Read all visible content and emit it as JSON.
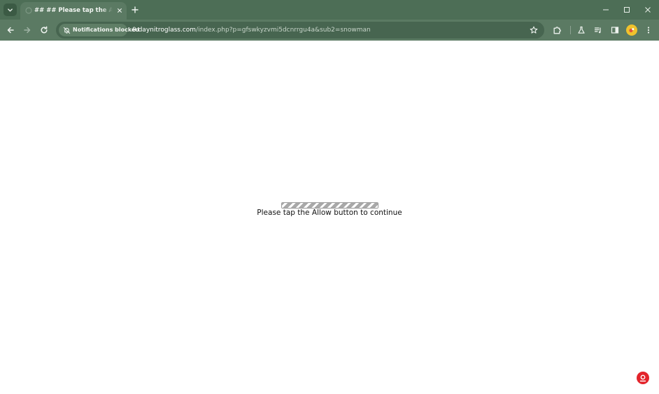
{
  "browser": {
    "tab": {
      "title": "## ## Please tap the Allow button to continue"
    },
    "omnibox": {
      "notification_chip": "Notifications blocked",
      "url_host": "0.daynitroglass.com",
      "url_path": "/index.php?p=gfswkyzvmi5dcnrrgu4a&sub2=snowman"
    },
    "icons": {
      "tab_search": "chevron-down-icon",
      "favicon": "globe-icon",
      "tab_close": "close-icon",
      "new_tab": "plus-icon",
      "minimize": "minimize-icon",
      "maximize": "maximize-icon",
      "close_window": "close-window-icon",
      "back": "arrow-left-icon",
      "forward": "arrow-right-icon",
      "reload": "reload-icon",
      "notifications_blocked": "bell-off-icon",
      "bookmark": "star-icon",
      "extensions": "puzzle-icon",
      "labs": "flask-icon",
      "media": "music-queue-icon",
      "side_panel": "side-panel-icon",
      "profile": "profile-avatar",
      "menu": "more-vertical-icon"
    },
    "colors": {
      "frame": "#4d6e56",
      "toolbar": "#5b7a63",
      "omnibox": "#476550"
    }
  },
  "page": {
    "progress_fraction": 1.0,
    "message": "Please tap the Allow button to continue",
    "corner_badge_icon": "location-pin-icon",
    "colors": {
      "badge": "#e3242b"
    }
  }
}
